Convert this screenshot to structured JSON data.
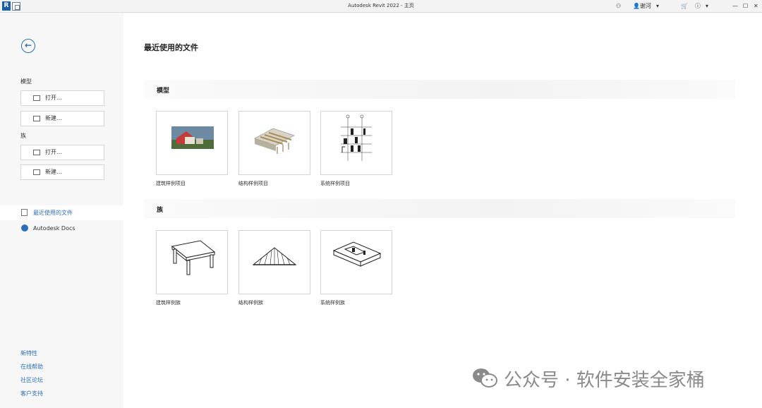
{
  "window": {
    "title": "Autodesk Revit 2022 - 主页",
    "user": "谢河"
  },
  "sidebar": {
    "models_label": "模型",
    "model_open": "打开...",
    "model_new": "新建...",
    "families_label": "族",
    "family_open": "打开...",
    "family_new": "新建...",
    "nav": [
      {
        "label": "最近使用的文件"
      },
      {
        "label": "Autodesk Docs"
      }
    ],
    "links": [
      "新特性",
      "在线帮助",
      "社区论坛",
      "客户支持"
    ]
  },
  "main": {
    "title": "最近使用的文件",
    "models_section": "模型",
    "families_section": "族",
    "model_cards": [
      {
        "label": "建筑样例项目"
      },
      {
        "label": "结构样例项目"
      },
      {
        "label": "系统样例项目"
      }
    ],
    "family_cards": [
      {
        "label": "建筑样例族"
      },
      {
        "label": "结构样例族"
      },
      {
        "label": "系统样例族"
      }
    ]
  },
  "watermark": "公众号 · 软件安装全家桶",
  "colors": {
    "accent": "#2d6fb8",
    "sidebar_bg": "#f7f7f8"
  }
}
